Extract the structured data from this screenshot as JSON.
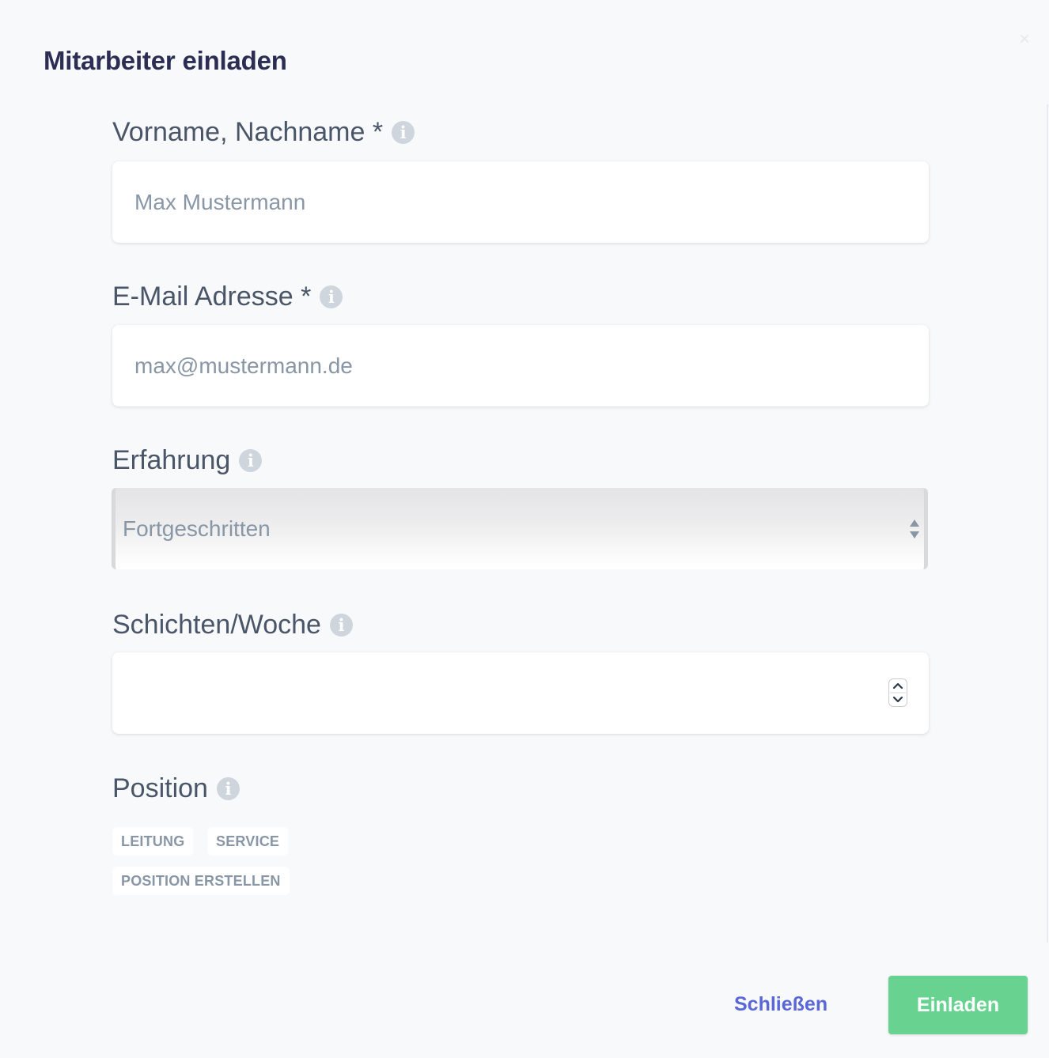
{
  "modal": {
    "title": "Mitarbeiter einladen",
    "close_symbol": "×"
  },
  "fields": {
    "name": {
      "label": "Vorname, Nachname *",
      "placeholder": "Max Mustermann",
      "info_icon": "info-circle-icon"
    },
    "email": {
      "label": "E-Mail Adresse *",
      "placeholder": "max@mustermann.de",
      "info_icon": "info-circle-icon"
    },
    "experience": {
      "label": "Erfahrung",
      "selected": "Fortgeschritten",
      "info_icon": "info-circle-icon"
    },
    "shifts": {
      "label": "Schichten/Woche",
      "value": "",
      "info_icon": "info-circle-icon"
    },
    "position": {
      "label": "Position",
      "info_icon": "info-circle-icon",
      "chips": [
        "LEITUNG",
        "SERVICE"
      ],
      "create_label": "POSITION ERSTELLEN"
    }
  },
  "actions": {
    "close_label": "Schließen",
    "invite_label": "Einladen"
  },
  "colors": {
    "title": "#2b2d52",
    "link": "#5a67d8",
    "primary_button": "#68d391",
    "background": "#f7f9fb"
  }
}
